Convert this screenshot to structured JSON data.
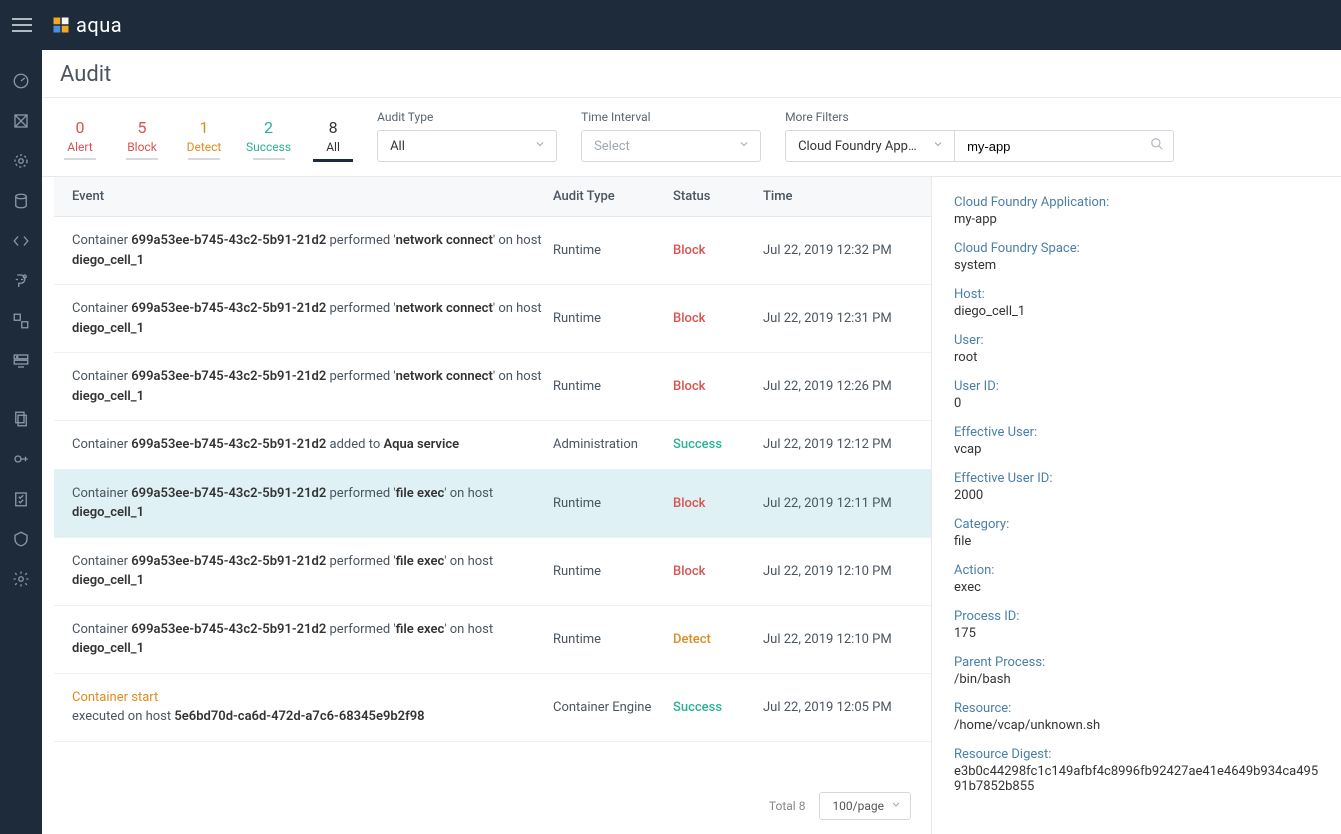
{
  "brand": "aqua",
  "page": {
    "title": "Audit"
  },
  "status_tabs": [
    {
      "key": "alert",
      "count": "0",
      "label": "Alert"
    },
    {
      "key": "block",
      "count": "5",
      "label": "Block"
    },
    {
      "key": "detect",
      "count": "1",
      "label": "Detect"
    },
    {
      "key": "success",
      "count": "2",
      "label": "Success"
    },
    {
      "key": "all",
      "count": "8",
      "label": "All",
      "active": true
    }
  ],
  "filters": {
    "audit_type_label": "Audit Type",
    "audit_type_value": "All",
    "time_interval_label": "Time Interval",
    "time_interval_placeholder": "Select",
    "more_filters_label": "More Filters",
    "more_filters_value": "Cloud Foundry Application",
    "search_value": "my-app"
  },
  "table": {
    "columns": {
      "event": "Event",
      "type": "Audit Type",
      "status": "Status",
      "time": "Time"
    },
    "rows": [
      {
        "container_id": "699a53ee-b745-43c2-5b91-21d2",
        "action": "network connect",
        "host": "diego_cell_1",
        "type": "Runtime",
        "status": "Block",
        "time": "Jul 22, 2019 12:32 PM",
        "kind": "perform"
      },
      {
        "container_id": "699a53ee-b745-43c2-5b91-21d2",
        "action": "network connect",
        "host": "diego_cell_1",
        "type": "Runtime",
        "status": "Block",
        "time": "Jul 22, 2019 12:31 PM",
        "kind": "perform"
      },
      {
        "container_id": "699a53ee-b745-43c2-5b91-21d2",
        "action": "network connect",
        "host": "diego_cell_1",
        "type": "Runtime",
        "status": "Block",
        "time": "Jul 22, 2019 12:26 PM",
        "kind": "perform"
      },
      {
        "container_id": "699a53ee-b745-43c2-5b91-21d2",
        "type": "Administration",
        "status": "Success",
        "time": "Jul 22, 2019 12:12 PM",
        "kind": "added",
        "service": "Aqua service"
      },
      {
        "container_id": "699a53ee-b745-43c2-5b91-21d2",
        "action": "file exec",
        "host": "diego_cell_1",
        "type": "Runtime",
        "status": "Block",
        "time": "Jul 22, 2019 12:11 PM",
        "kind": "perform",
        "selected": true
      },
      {
        "container_id": "699a53ee-b745-43c2-5b91-21d2",
        "action": "file exec",
        "host": "diego_cell_1",
        "type": "Runtime",
        "status": "Block",
        "time": "Jul 22, 2019 12:10 PM",
        "kind": "perform"
      },
      {
        "container_id": "699a53ee-b745-43c2-5b91-21d2",
        "action": "file exec",
        "host": "diego_cell_1",
        "type": "Runtime",
        "status": "Detect",
        "time": "Jul 22, 2019 12:10 PM",
        "kind": "perform"
      },
      {
        "kind": "start",
        "link_text": "Container start",
        "host_id": "5e6bd70d-ca6d-472d-a7c6-68345e9b2f98",
        "type": "Container Engine",
        "status": "Success",
        "time": "Jul 22, 2019 12:05 PM"
      }
    ],
    "footer": {
      "total": "Total 8",
      "page_size": "100/page"
    }
  },
  "detail": [
    {
      "k": "Cloud Foundry Application:",
      "v": "my-app"
    },
    {
      "k": "Cloud Foundry Space:",
      "v": "system"
    },
    {
      "k": "Host:",
      "v": "diego_cell_1"
    },
    {
      "k": "User:",
      "v": "root"
    },
    {
      "k": "User ID:",
      "v": "0"
    },
    {
      "k": "Effective User:",
      "v": "vcap"
    },
    {
      "k": "Effective User ID:",
      "v": "2000"
    },
    {
      "k": "Category:",
      "v": "file"
    },
    {
      "k": "Action:",
      "v": "exec"
    },
    {
      "k": "Process ID:",
      "v": "175"
    },
    {
      "k": "Parent Process:",
      "v": "/bin/bash"
    },
    {
      "k": "Resource:",
      "v": "/home/vcap/unknown.sh"
    },
    {
      "k": "Resource Digest:",
      "v": "e3b0c44298fc1c149afbf4c8996fb92427ae41e4649b934ca49591b7852b855"
    }
  ]
}
